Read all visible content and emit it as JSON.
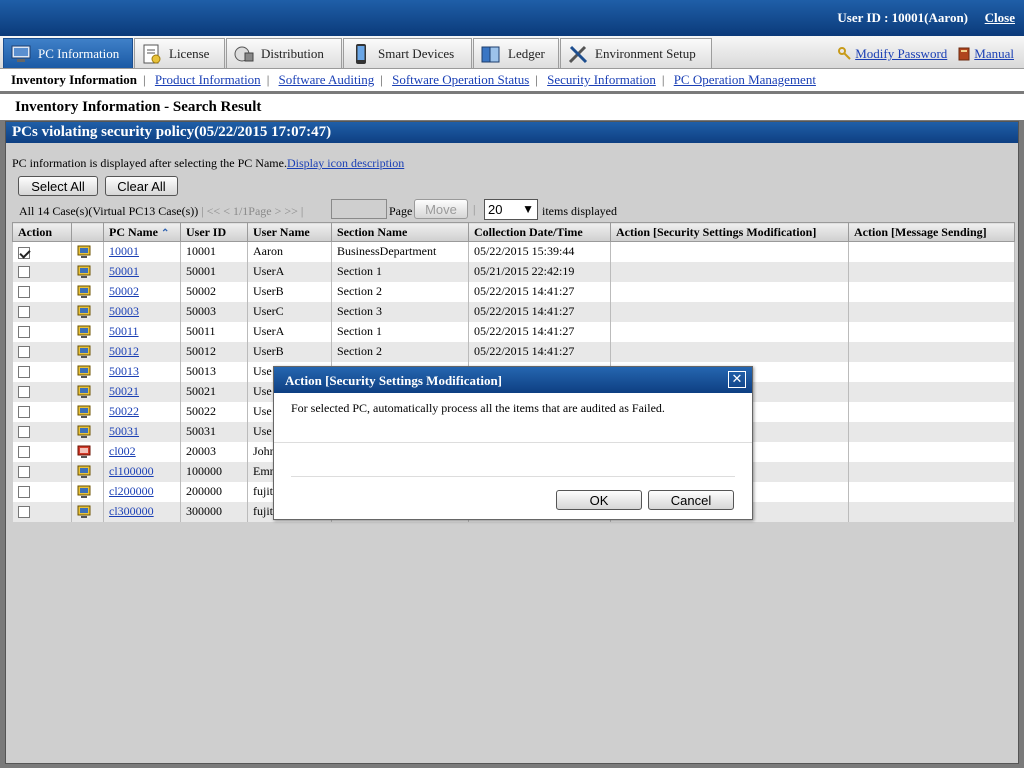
{
  "header": {
    "user_id_text": "User ID : 10001(Aaron)",
    "close_label": "Close"
  },
  "tabs": [
    {
      "label": "PC Information",
      "icon": "pc-info-icon",
      "active": true
    },
    {
      "label": "License",
      "icon": "license-icon",
      "active": false
    },
    {
      "label": "Distribution",
      "icon": "distribution-icon",
      "active": false
    },
    {
      "label": "Smart Devices",
      "icon": "smart-device-icon",
      "active": false
    },
    {
      "label": "Ledger",
      "icon": "ledger-icon",
      "active": false
    },
    {
      "label": "Environment Setup",
      "icon": "environment-setup-icon",
      "active": false
    }
  ],
  "right_links": {
    "modify_password": "Modify Password",
    "manual": "Manual"
  },
  "subnav": {
    "current": "Inventory Information",
    "links": [
      "Product Information",
      "Software Auditing",
      "Software Operation Status",
      "Security Information",
      "PC Operation Management"
    ]
  },
  "page_title": "Inventory Information - Search Result",
  "panel_title": "PCs violating security policy(05/22/2015 17:07:47)",
  "hint": {
    "text": "PC information is displayed after selecting the PC Name.",
    "link": "Display icon description"
  },
  "buttons": {
    "select_all": "Select All",
    "clear_all": "Clear All",
    "move": "Move"
  },
  "pager": {
    "summary": "All 14 Case(s)(Virtual PC13 Case(s))",
    "nav": "<< < 1/1Page > >>",
    "page_label": "Page",
    "count": "20",
    "count_label": "items displayed"
  },
  "table": {
    "headers": [
      "Action",
      "",
      "PC Name",
      "User ID",
      "User Name",
      "Section Name",
      "Collection Date/Time",
      "Action [Security Settings Modification]",
      "Action [Message Sending]"
    ],
    "rows": [
      {
        "checked": true,
        "pc": "10001",
        "uid": "10001",
        "user": "Aaron",
        "section": "BusinessDepartment",
        "date": "05/22/2015 15:39:44",
        "icon": "virtual-pc-icon"
      },
      {
        "checked": false,
        "pc": "50001",
        "uid": "50001",
        "user": "UserA",
        "section": "Section 1",
        "date": "05/21/2015 22:42:19",
        "icon": "virtual-pc-icon"
      },
      {
        "checked": false,
        "pc": "50002",
        "uid": "50002",
        "user": "UserB",
        "section": "Section 2",
        "date": "05/22/2015 14:41:27",
        "icon": "virtual-pc-icon"
      },
      {
        "checked": false,
        "pc": "50003",
        "uid": "50003",
        "user": "UserC",
        "section": "Section 3",
        "date": "05/22/2015 14:41:27",
        "icon": "virtual-pc-icon"
      },
      {
        "checked": false,
        "pc": "50011",
        "uid": "50011",
        "user": "UserA",
        "section": "Section 1",
        "date": "05/22/2015 14:41:27",
        "icon": "virtual-pc-icon"
      },
      {
        "checked": false,
        "pc": "50012",
        "uid": "50012",
        "user": "UserB",
        "section": "Section 2",
        "date": "05/22/2015 14:41:27",
        "icon": "virtual-pc-icon"
      },
      {
        "checked": false,
        "pc": "50013",
        "uid": "50013",
        "user": "Use",
        "section": "",
        "date": "",
        "icon": "virtual-pc-icon"
      },
      {
        "checked": false,
        "pc": "50021",
        "uid": "50021",
        "user": "Use",
        "section": "",
        "date": "",
        "icon": "virtual-pc-icon"
      },
      {
        "checked": false,
        "pc": "50022",
        "uid": "50022",
        "user": "Use",
        "section": "",
        "date": "",
        "icon": "virtual-pc-icon"
      },
      {
        "checked": false,
        "pc": "50031",
        "uid": "50031",
        "user": "Use",
        "section": "",
        "date": "",
        "icon": "virtual-pc-icon"
      },
      {
        "checked": false,
        "pc": "cl002",
        "uid": "20003",
        "user": "John",
        "section": "",
        "date": "",
        "icon": "physical-pc-icon"
      },
      {
        "checked": false,
        "pc": "cl100000",
        "uid": "100000",
        "user": "Emn",
        "section": "",
        "date": "",
        "icon": "virtual-pc-icon"
      },
      {
        "checked": false,
        "pc": "cl200000",
        "uid": "200000",
        "user": "fujit",
        "section": "",
        "date": "",
        "icon": "virtual-pc-icon"
      },
      {
        "checked": false,
        "pc": "cl300000",
        "uid": "300000",
        "user": "fujit",
        "section": "",
        "date": "",
        "icon": "virtual-pc-icon"
      }
    ]
  },
  "dialog": {
    "title": "Action [Security Settings Modification]",
    "message": "For selected PC, automatically process all the items that are audited as Failed.",
    "ok": "OK",
    "cancel": "Cancel"
  },
  "colors": {
    "header_blue": "#0b3a7a",
    "link_blue": "#1a3fb5",
    "panel_gray": "#cfcfcf"
  }
}
